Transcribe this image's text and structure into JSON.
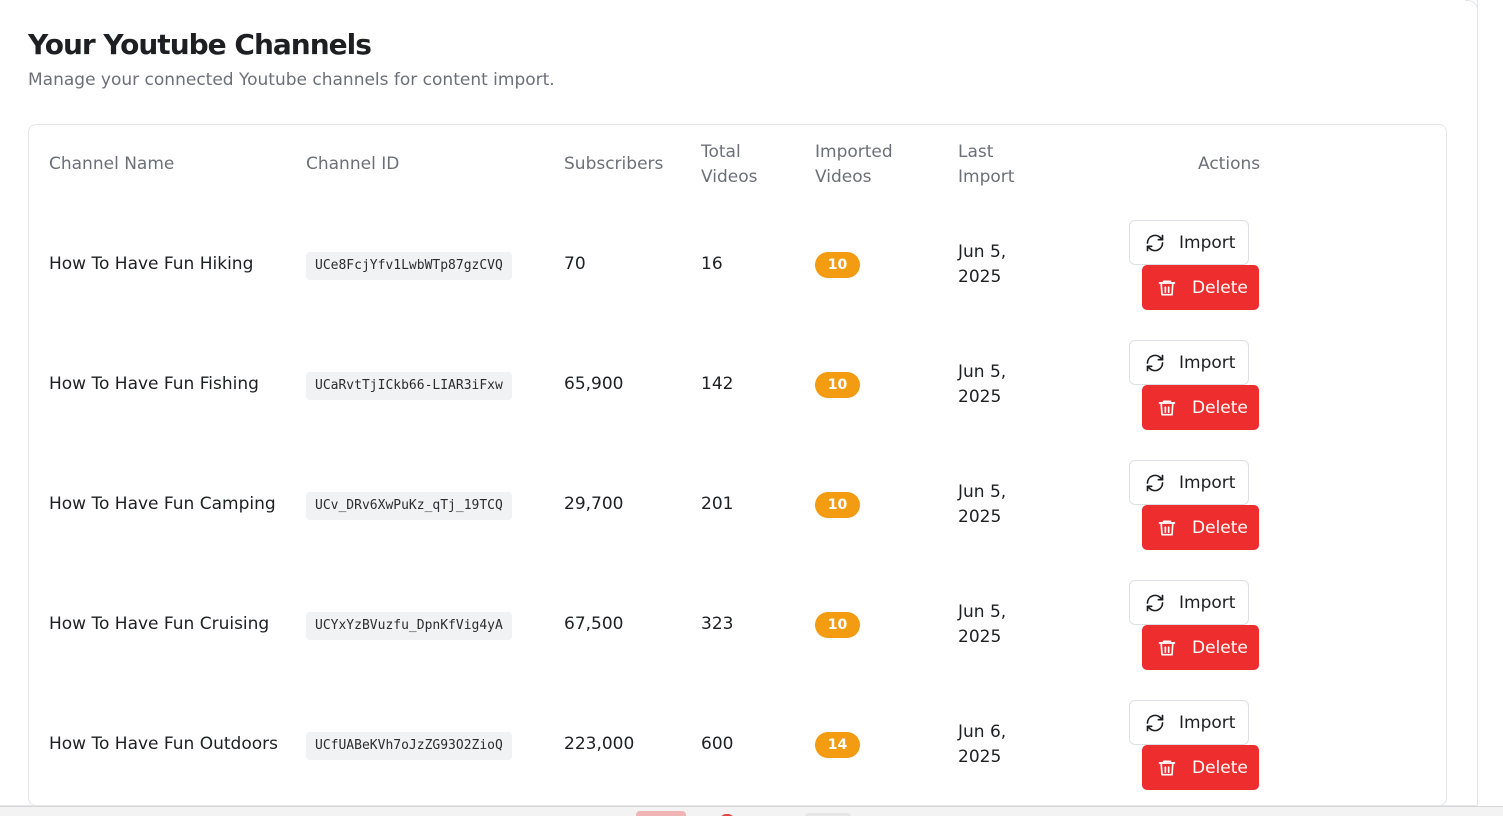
{
  "page": {
    "title": "Your Youtube Channels",
    "subtitle": "Manage your connected Youtube channels for content import."
  },
  "table": {
    "headers": {
      "channel_name": "Channel Name",
      "channel_id": "Channel ID",
      "subscribers": "Subscribers",
      "total_videos_1": "Total",
      "total_videos_2": "Videos",
      "imported_videos_1": "Imported",
      "imported_videos_2": "Videos",
      "last_import_1": "Last",
      "last_import_2": "Import",
      "actions": "Actions"
    },
    "rows": [
      {
        "name": "How To Have Fun Hiking",
        "id": "UCe8FcjYfv1LwbWTp87gzCVQ",
        "subscribers": "70",
        "total_videos": "16",
        "imported": "10",
        "last_import_1": "Jun 5,",
        "last_import_2": "2025"
      },
      {
        "name": "How To Have Fun Fishing",
        "id": "UCaRvtTjICkb66-LIAR3iFxw",
        "subscribers": "65,900",
        "total_videos": "142",
        "imported": "10",
        "last_import_1": "Jun 5,",
        "last_import_2": "2025"
      },
      {
        "name": "How To Have Fun Camping",
        "id": "UCv_DRv6XwPuKz_qTj_19TCQ",
        "subscribers": "29,700",
        "total_videos": "201",
        "imported": "10",
        "last_import_1": "Jun 5,",
        "last_import_2": "2025"
      },
      {
        "name": "How To Have Fun Cruising",
        "id": "UCYxYzBVuzfu_DpnKfVig4yA",
        "subscribers": "67,500",
        "total_videos": "323",
        "imported": "10",
        "last_import_1": "Jun 5,",
        "last_import_2": "2025"
      },
      {
        "name": "How To Have Fun Outdoors",
        "id": "UCfUABeKVh7oJzZG93O2ZioQ",
        "subscribers": "223,000",
        "total_videos": "600",
        "imported": "14",
        "last_import_1": "Jun 6,",
        "last_import_2": "2025"
      }
    ],
    "actions": {
      "import_label": "Import",
      "delete_label": "Delete"
    }
  },
  "icons": {
    "import": "refresh-icon",
    "delete": "trash-icon"
  },
  "colors": {
    "delete_button": "#ee2e2e",
    "imported_badge": "#f39c12"
  }
}
